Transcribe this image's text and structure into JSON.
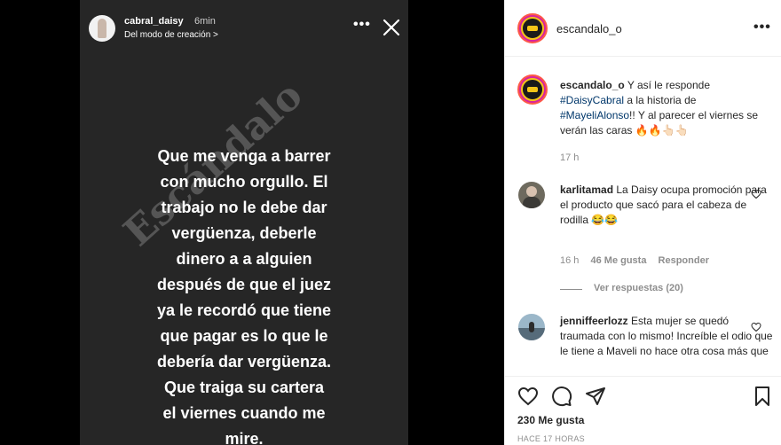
{
  "story": {
    "username": "cabral_daisy",
    "time": "6min",
    "source": "Del modo de creación >",
    "text_lines": [
      "Que me venga a barrer",
      "con mucho orgullo. El",
      "trabajo no le debe dar",
      "vergüenza, deberle",
      "dinero a a alguien",
      "después de que el juez",
      "ya le recordó que tiene",
      "que pagar es lo que le",
      "debería dar vergüenza.",
      "Que traiga su cartera",
      "el viernes cuando me",
      "mire."
    ],
    "watermark": "Escándalo"
  },
  "post": {
    "username": "escandalo_o",
    "caption": {
      "username": "escandalo_o",
      "t1": " Y así le responde ",
      "tag1": "#DaisyCabral",
      "t2": " a la historia de ",
      "tag2": "#MayeliAlonso",
      "t3": "!! Y al parecer el viernes se verán las caras 🔥🔥👆🏻👆🏻",
      "time": "17 h"
    },
    "comments": [
      {
        "username": "karlitamad",
        "text": " La Daisy ocupa promoción para el producto que sacó para el cabeza de rodilla 😂😂",
        "time": "16 h",
        "likes": "46 Me gusta",
        "reply": "Responder",
        "view_replies": "Ver respuestas (20)"
      },
      {
        "username": "jenniffeerlozz",
        "text": " Esta mujer se quedó traumada con lo mismo! Increíble el odio que le tiene a Maveli no hace otra cosa más que"
      }
    ],
    "likes": "230 Me gusta",
    "time_ago": "HACE 17 HORAS"
  },
  "colors": {
    "link": "#00376b",
    "muted": "#8e8e8e",
    "story_bg": "#262626"
  }
}
